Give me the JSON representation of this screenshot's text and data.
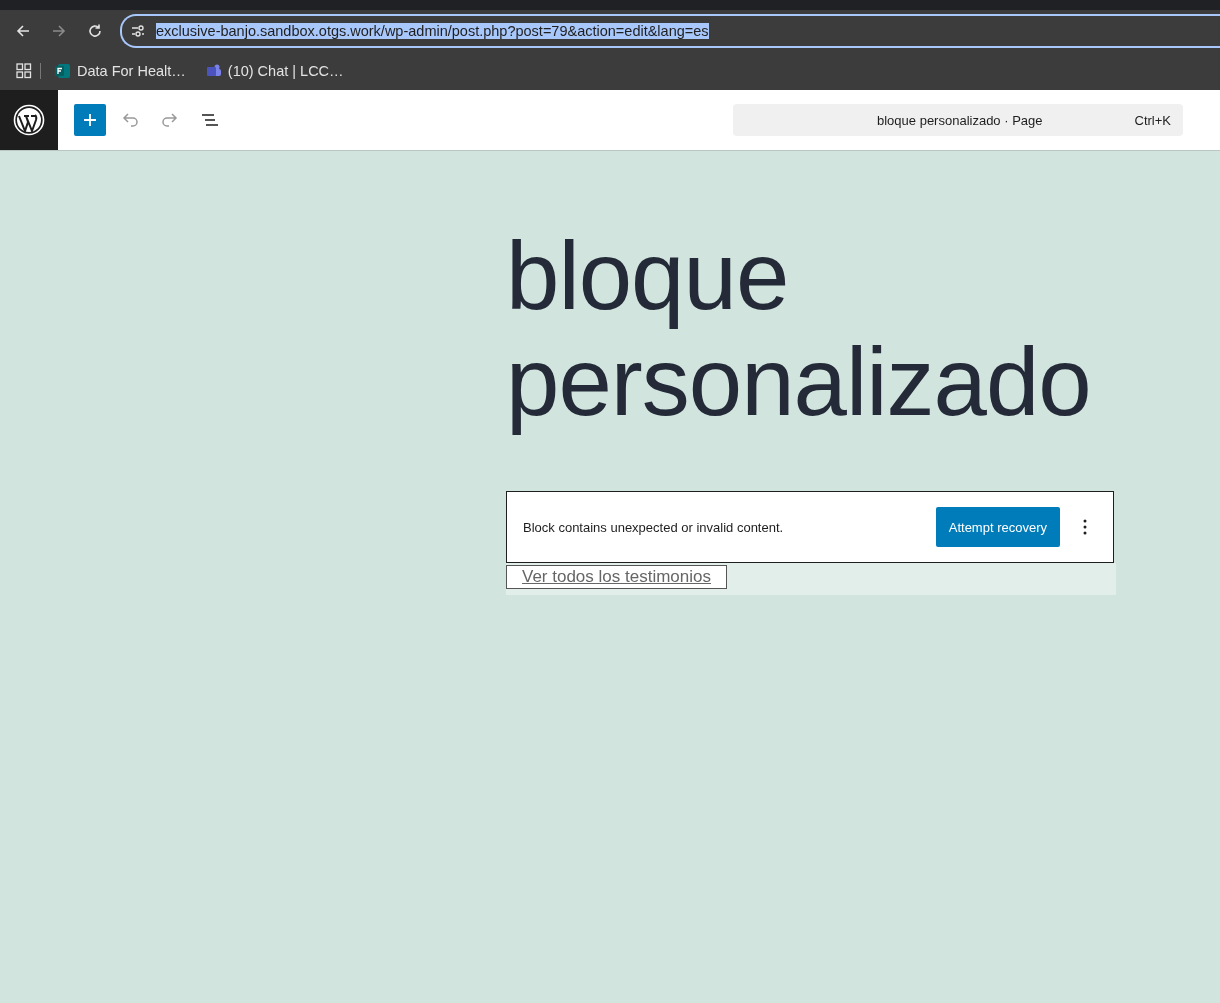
{
  "browser": {
    "url": "exclusive-banjo.sandbox.otgs.work/wp-admin/post.php?post=79&action=edit&lang=es",
    "url_selected": true,
    "bookmarks": [
      {
        "label": "Data For Healt…",
        "kind": "forms"
      },
      {
        "label": "(10) Chat | LCC…",
        "kind": "teams"
      }
    ]
  },
  "toolbar": {
    "command_bar": {
      "title": "bloque personalizado · Page",
      "shortcut": "Ctrl+K"
    }
  },
  "content": {
    "title": "bloque personalizado",
    "block_warning": {
      "message": "Block contains unexpected or invalid content.",
      "button": "Attempt recovery"
    },
    "link": "Ver todos los testimonios"
  }
}
